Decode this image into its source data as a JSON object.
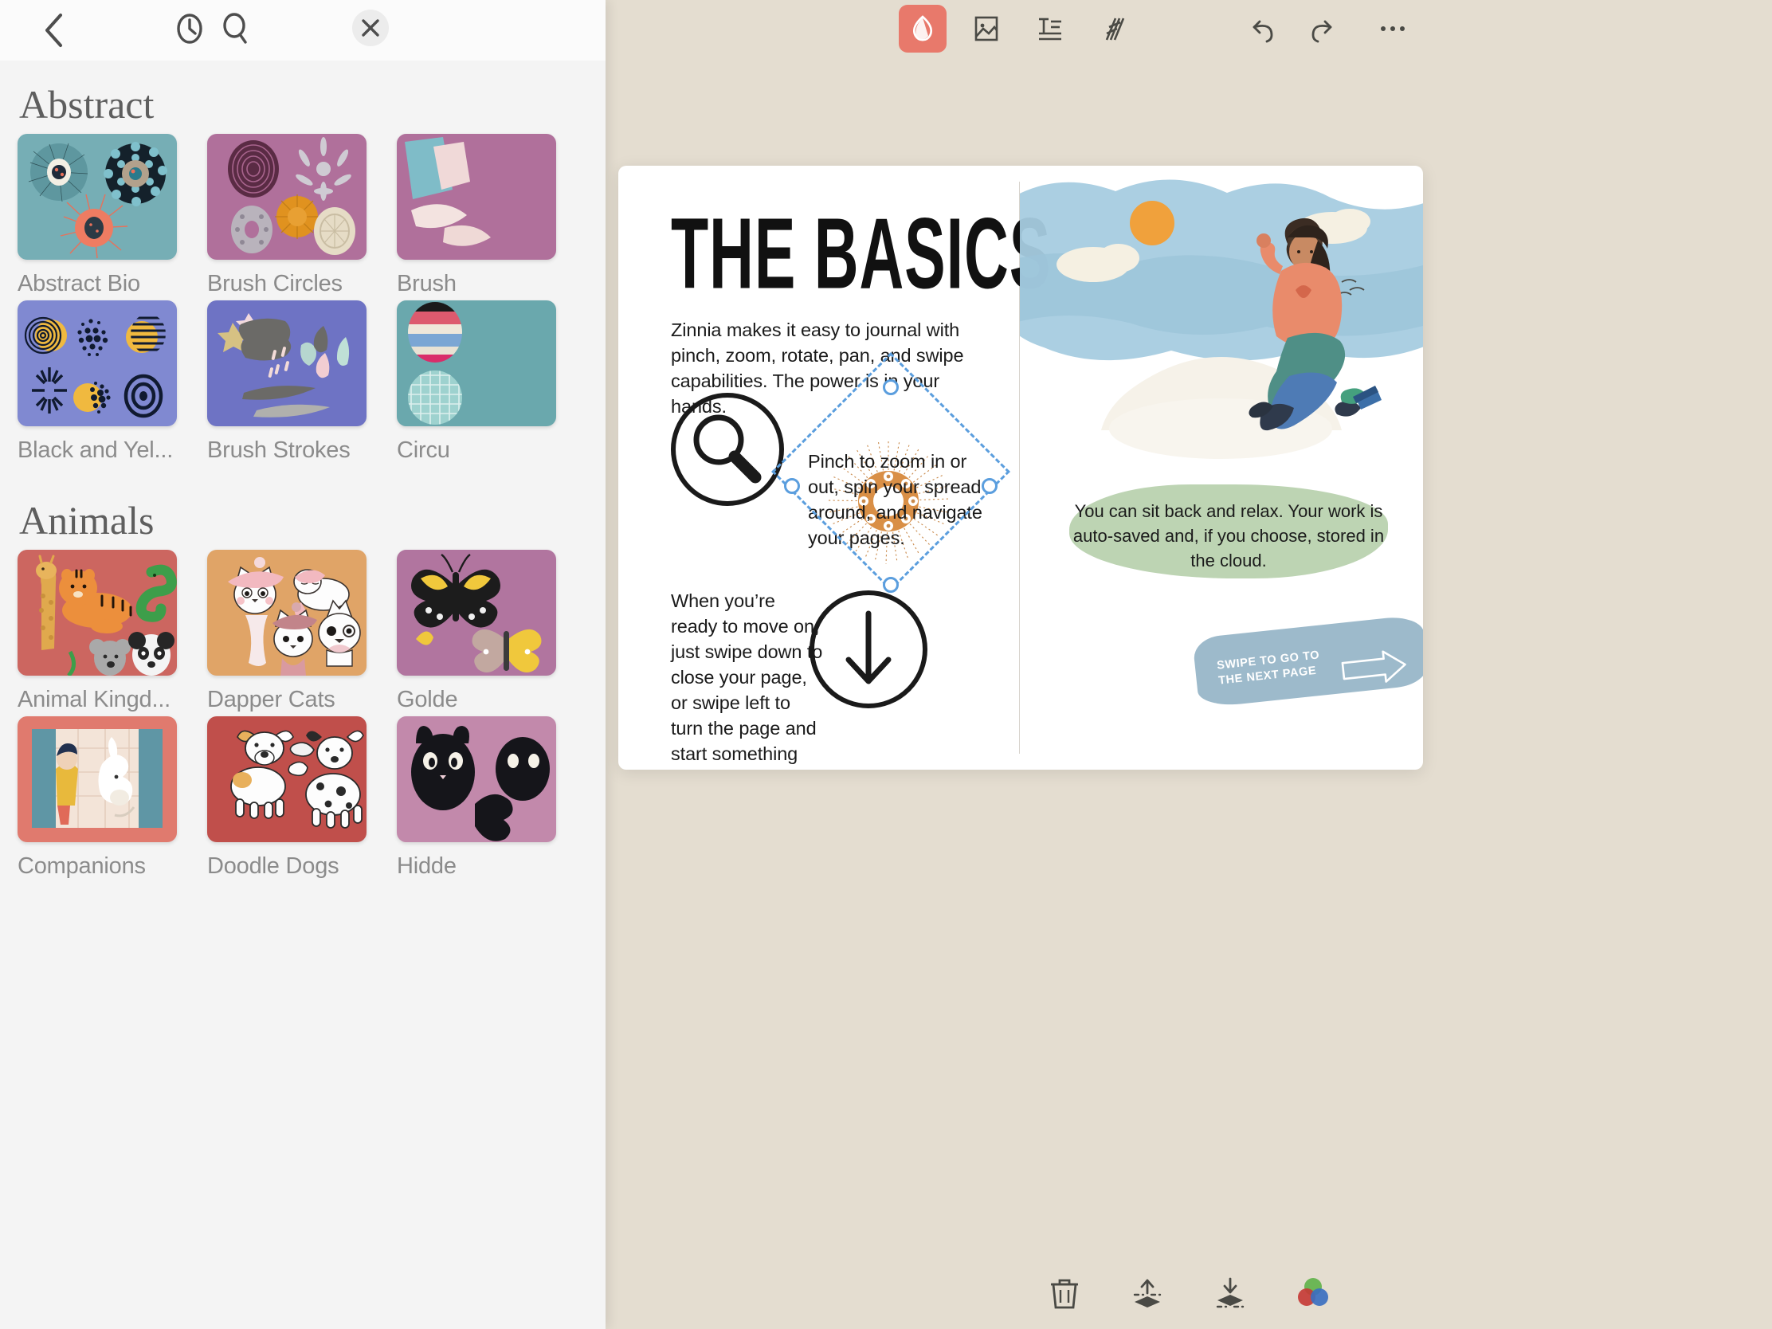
{
  "panel": {
    "toolbar": {
      "back_icon": "chevron-left-icon",
      "recent_icon": "clock-icon",
      "search_icon": "search-icon",
      "close_icon": "close-icon"
    },
    "sections": [
      {
        "title": "Abstract",
        "packs": [
          {
            "label": "Abstract Bio",
            "bg": "#76aeb5"
          },
          {
            "label": "Brush Circles",
            "bg": "#b0709b"
          },
          {
            "label": "Brush",
            "bg": "#b0709b"
          },
          {
            "label": "Black and Yel...",
            "bg": "#8089d1"
          },
          {
            "label": "Brush Strokes",
            "bg": "#6e73c4"
          },
          {
            "label": "Circu",
            "bg": "#6aa8ad"
          }
        ]
      },
      {
        "title": "Animals",
        "packs": [
          {
            "label": "Animal Kingd...",
            "bg": "#cc6660"
          },
          {
            "label": "Dapper Cats",
            "bg": "#e0a467"
          },
          {
            "label": "Golde",
            "bg": "#b1759f"
          },
          {
            "label": "Companions",
            "bg": "#e07a6e"
          },
          {
            "label": "Doodle Dogs",
            "bg": "#c04f4b"
          },
          {
            "label": "Hidde",
            "bg": "#c289ab"
          }
        ]
      }
    ]
  },
  "editor": {
    "topbar": {
      "sticker_label": "sticker-tool",
      "image_label": "image-tool",
      "text_label": "text-tool",
      "draw_label": "draw-tool",
      "undo_label": "undo",
      "redo_label": "redo",
      "more_label": "more-options",
      "active_accent": "#e8796b"
    },
    "page": {
      "title": "THE BASICS",
      "intro": "Zinnia makes it easy to journal with pinch, zoom, rotate, pan, and swipe capabilities. The power is in your hands.",
      "pinch": "Pinch to zoom in or out, spin your spread around, and navigate your pages.",
      "swipe": "When you’re ready to move on, just swipe down to close your page, or swipe left to turn the page and start something fresh.",
      "relax": "You can sit back and relax. Your work is auto-saved and, if you choose, stored in the cloud.",
      "next_page_line1": "SWIPE TO GO TO",
      "next_page_line2": "THE NEXT PAGE"
    },
    "selection": {
      "handle_color": "#5b9ede",
      "sticker_color": "#c98a4b"
    },
    "bottombar": {
      "delete_label": "delete",
      "bring_forward_label": "bring-forward",
      "send_backward_label": "send-backward",
      "color_label": "color-blend"
    }
  }
}
